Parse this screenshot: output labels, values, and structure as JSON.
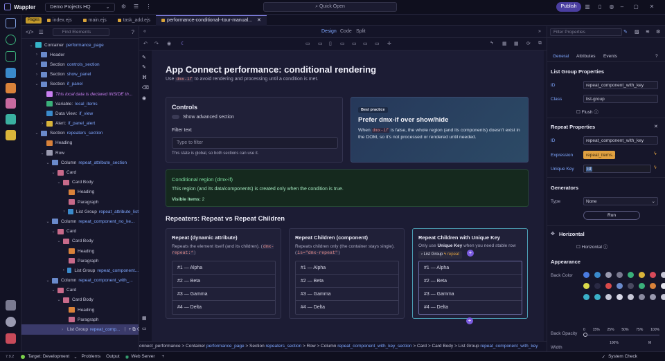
{
  "app": {
    "name": "Wappler",
    "project": "Demo Projects HQ",
    "quick_open": "Quick Open",
    "publish": "Publish"
  },
  "tabs": {
    "pages_badge": "Pages",
    "items": [
      "index.ejs",
      "main.ejs",
      "task_add.ejs",
      "performance-conditional--tour-manual..."
    ]
  },
  "left_panel": {
    "find_placeholder": "Find Elements",
    "tree": [
      {
        "label": "Container",
        "link": "performance_page",
        "indent": 0,
        "color": "#36b4c8",
        "arrow": "v"
      },
      {
        "label": "Header",
        "link": "",
        "indent": 1,
        "color": "#6a8acb",
        "arrow": ">"
      },
      {
        "label": "Section",
        "link": "controls_section",
        "indent": 1,
        "color": "#6a8acb",
        "arrow": ">"
      },
      {
        "label": "Section",
        "link": "show_panel",
        "indent": 1,
        "color": "#6a8acb",
        "arrow": ">"
      },
      {
        "label": "Section",
        "link": "if_panel",
        "indent": 1,
        "color": "#6a8acb",
        "arrow": "v"
      },
      {
        "label": "This local data is declared INSIDE th...",
        "link": "",
        "indent": 2,
        "color": "#c87ff0",
        "arrow": "",
        "note": true
      },
      {
        "label": "Variable:",
        "link": "local_items",
        "indent": 2,
        "color": "#3ab07a",
        "arrow": ""
      },
      {
        "label": "Data View:",
        "link": "if_view",
        "indent": 2,
        "color": "#3a8acb",
        "arrow": ""
      },
      {
        "label": "Alert:",
        "link": "if_panel_alert",
        "indent": 2,
        "color": "#d9b43a",
        "arrow": ">"
      },
      {
        "label": "Section",
        "link": "repeaters_section",
        "indent": 1,
        "color": "#6a8acb",
        "arrow": "v"
      },
      {
        "label": "Heading",
        "link": "",
        "indent": 2,
        "color": "#d9823a",
        "arrow": ""
      },
      {
        "label": "Row",
        "link": "",
        "indent": 2,
        "color": "#9a9ab0",
        "arrow": "v"
      },
      {
        "label": "Column",
        "link": "repeat_attribute_section",
        "indent": 3,
        "color": "#6a8acb",
        "arrow": "v"
      },
      {
        "label": "Card",
        "link": "",
        "indent": 4,
        "color": "#c86a8a",
        "arrow": "v"
      },
      {
        "label": "Card Body",
        "link": "",
        "indent": 5,
        "color": "#c86a8a",
        "arrow": "v"
      },
      {
        "label": "Heading",
        "link": "",
        "indent": 6,
        "color": "#d9823a",
        "arrow": ""
      },
      {
        "label": "Paragraph",
        "link": "",
        "indent": 6,
        "color": "#c86a8a",
        "arrow": ""
      },
      {
        "label": "List Group",
        "link": "repeat_attribute_list",
        "indent": 6,
        "color": "#3a8acb",
        "arrow": ">"
      },
      {
        "label": "Column",
        "link": "repeat_component_no_ke...",
        "indent": 3,
        "color": "#6a8acb",
        "arrow": "v"
      },
      {
        "label": "Card",
        "link": "",
        "indent": 4,
        "color": "#c86a8a",
        "arrow": "v"
      },
      {
        "label": "Card Body",
        "link": "",
        "indent": 5,
        "color": "#c86a8a",
        "arrow": "v"
      },
      {
        "label": "Heading",
        "link": "",
        "indent": 6,
        "color": "#d9823a",
        "arrow": ""
      },
      {
        "label": "Paragraph",
        "link": "",
        "indent": 6,
        "color": "#c86a8a",
        "arrow": ""
      },
      {
        "label": "List Group",
        "link": "repeat_component...",
        "indent": 6,
        "color": "#3a8acb",
        "arrow": ">"
      },
      {
        "label": "Column",
        "link": "repeat_component_with_...",
        "indent": 3,
        "color": "#6a8acb",
        "arrow": "v"
      },
      {
        "label": "Card",
        "link": "",
        "indent": 4,
        "color": "#c86a8a",
        "arrow": "v"
      },
      {
        "label": "Card Body",
        "link": "",
        "indent": 5,
        "color": "#c86a8a",
        "arrow": "v"
      },
      {
        "label": "Heading",
        "link": "",
        "indent": 6,
        "color": "#d9823a",
        "arrow": ""
      },
      {
        "label": "Paragraph",
        "link": "",
        "indent": 6,
        "color": "#c86a8a",
        "arrow": ""
      },
      {
        "label": "List Group",
        "link": "repeat_comp...",
        "indent": 6,
        "color": "#3a8acb",
        "arrow": ">",
        "selected": true
      }
    ]
  },
  "design_tabs": {
    "design": "Design",
    "code": "Code",
    "split": "Split"
  },
  "page": {
    "title": "App Connect performance: conditional rendering",
    "subtitle_pre": "Use",
    "subtitle_code": "dmx-if",
    "subtitle_post": "to avoid rendering and processing until a condition is met.",
    "controls": {
      "title": "Controls",
      "toggle_label": "Show advanced section",
      "filter_label": "Filter text",
      "filter_placeholder": "Type to filter",
      "note": "This state is global, so both sections can use it."
    },
    "best_practice": {
      "badge": "Best practice",
      "title": "Prefer dmx-if over show/hide",
      "body_pre": "When",
      "body_code": "dmx-if",
      "body_post": "is false, the whole region (and its components) doesn't exist in the DOM, so it's not processed or rendered until needed."
    },
    "conditional": {
      "title": "Conditional region (dmx-if)",
      "body": "This region (and its data/components) is created only when the condition is true.",
      "count_label": "Visible items:",
      "count_value": "2"
    },
    "repeaters_title": "Repeaters: Repeat vs Repeat Children",
    "cards": [
      {
        "title": "Repeat (dynamic attribute)",
        "desc": "Repeats the element itself (and its children).",
        "code": "dmx-repeat:*",
        "items": [
          "#1 — Alpha",
          "#2 — Beta",
          "#3 — Gamma",
          "#4 — Delta"
        ]
      },
      {
        "title": "Repeat Children (component)",
        "desc": "Repeats children only (the container stays single).",
        "code": "is=\"dmx-repeat\"",
        "items": [
          "#1 — Alpha",
          "#2 — Beta",
          "#3 — Gamma",
          "#4 — Delta"
        ]
      },
      {
        "title": "Repeat Children with Unique Key",
        "desc_pre": "Only use",
        "desc_bold": "Unique Key",
        "desc_post": "when you need stable row",
        "items": [
          "#1 — Alpha",
          "#2 — Beta",
          "#3 — Gamma",
          "#4 — Delta"
        ],
        "tag_label": "List Group",
        "tag_repeat": "repeat"
      }
    ]
  },
  "breadcrumbs": [
    {
      "text": "onnect_performance",
      "link": false
    },
    {
      "text": " > Container ",
      "link": false
    },
    {
      "text": "performance_page",
      "link": true
    },
    {
      "text": " > Section ",
      "link": false
    },
    {
      "text": "repeaters_section",
      "link": true
    },
    {
      "text": " > Row > Column ",
      "link": false
    },
    {
      "text": "repeat_component_with_key_section",
      "link": true
    },
    {
      "text": " > Card > Card Body > List Group ",
      "link": false
    },
    {
      "text": "repeat_component_with_key",
      "link": true
    }
  ],
  "right_panel": {
    "filter_placeholder": "Filter Properties",
    "tabs": [
      "General",
      "Attributes",
      "Events"
    ],
    "list_group_title": "List Group Properties",
    "id_label": "ID",
    "id_value": "repeat_component_with_key",
    "class_label": "Class",
    "class_value": "list-group",
    "flush_label": "Flush",
    "repeat_title": "Repeat Properties",
    "repeat_id_value": "repeat_component_with_key",
    "expression_label": "Expression",
    "expression_value": "repeat_items...",
    "unique_key_label": "Unique Key",
    "unique_key_value": "id",
    "generators_title": "Generators",
    "type_label": "Type",
    "type_value": "None",
    "run_label": "Run",
    "horizontal_title": "Horizontal",
    "horizontal_label": "Horizontal",
    "appearance_title": "Appearance",
    "back_color_label": "Back Color",
    "back_opacity_label": "Back Opacity",
    "opacity_ticks": [
      "0",
      "15%",
      "25%",
      "50%",
      "75%",
      "100%"
    ],
    "width_label": "Width",
    "width_ticks": [
      "100%",
      "M"
    ]
  },
  "status": {
    "version": "7.9.2",
    "target": "Target: Development",
    "problems": "Problems",
    "output": "Output",
    "web_server": "Web Server",
    "system_check": "System Check"
  },
  "colors": {
    "swatches": [
      "#4a7be0",
      "#3a8acb",
      "#9a9ab0",
      "#7a7a90",
      "#3ab07a",
      "#d9b43a",
      "#d94a5a",
      "#c8c8d8",
      "#d9d94a",
      "#2a2a44",
      "#d94a4a",
      "#6a8acb",
      "#4a4a60",
      "#3ab07a",
      "#d9823a",
      "#e8e8f0",
      "#3ab0c8",
      "#3ab0c8",
      "#c8c8d8",
      "#d9d9e8",
      "#c8c8d8",
      "#8a8aa0",
      "#9a9ab0",
      "#c8c8d8"
    ]
  }
}
